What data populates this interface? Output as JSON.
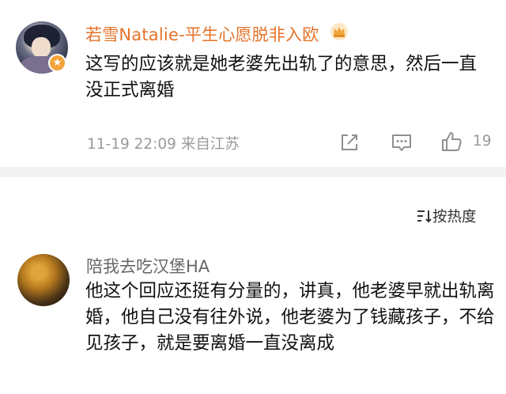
{
  "comment1": {
    "username": "若雪Natalie-平生心愿脱非入欧",
    "text": "这写的应该就是她老婆先出轨了的意思，然后一直没正式离婚",
    "date": "11-19 22:09",
    "location": "来自江苏",
    "like_count": "19"
  },
  "sort": {
    "label": "按热度"
  },
  "comment2": {
    "username": "陪我去吃汉堡HA",
    "text": "他这个回应还挺有分量的，讲真，他老婆早就出轨离婚，他自己没有往外说，他老婆为了钱藏孩子，不给见孩子，就是要离婚一直没离成"
  },
  "colors": {
    "username_vip": "#e5732a",
    "meta_gray": "#9a9a9a",
    "divider": "#f2f2f2"
  }
}
